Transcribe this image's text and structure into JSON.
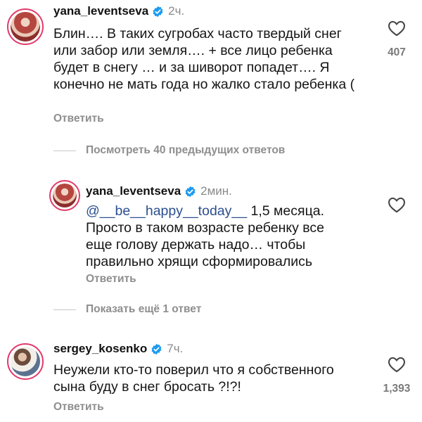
{
  "comments": [
    {
      "username": "yana_leventseva",
      "time": "2ч.",
      "text": "Блин…. В таких сугробах часто твердый снег или забор или земля…. + все лицо ребенка будет в снегу … и за шиворот попадет…. Я конечно не мать года но жалко стало ребенка (",
      "reply_label": "Ответить",
      "likes": "407"
    },
    {
      "username": "yana_leventseva",
      "time": "2мин.",
      "mention": "@__be__happy__today__",
      "text": " 1,5 месяца. Просто в таком возрасте ребенку все еще голову держать надо… чтобы правильно хрящи сформировались",
      "reply_label": "Ответить"
    },
    {
      "username": "sergey_kosenko",
      "time": "7ч.",
      "text": "Неужели кто-то поверил что я собственного сына буду в снег бросать ?!?!",
      "reply_label": "Ответить",
      "likes": "1,393"
    }
  ],
  "threads": {
    "view_previous": "Посмотреть 40 предыдущих ответов",
    "show_more": "Показать ещё 1 ответ"
  },
  "colors": {
    "accent_verified": "#1d9bf0",
    "avatar_ring": "#e23a6b",
    "mention": "#2b4f8f",
    "muted": "#8e8e8e"
  },
  "icons": {
    "verified": "verified-badge-icon",
    "like": "heart-outline-icon"
  }
}
